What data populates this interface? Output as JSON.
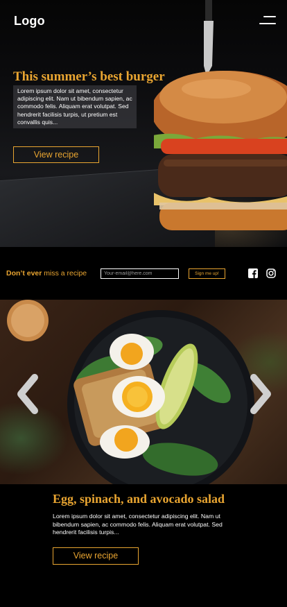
{
  "header": {
    "logo": "Logo"
  },
  "hero": {
    "title": "This summer’s best burger",
    "text": "Lorem ipsum dolor sit amet, consectetur adipiscing elit. Nam ut bibendum sapien, ac commodo felis. Aliquam erat volutpat. Sed hendrerit facilisis turpis, ut pretium est convallis quis...",
    "button": "View recipe"
  },
  "signup": {
    "tag_bold": "Don’t ever",
    "tag_rest": " miss a recipe",
    "email_placeholder": "Your-email@here.com",
    "button": "Sign me up!"
  },
  "feature": {
    "title": "Egg, spinach, and avocado salad",
    "text": "Lorem ipsum dolor sit amet, consectetur adipiscing elit. Nam ut bibendum sapien, ac commodo felis. Aliquam erat volutpat. Sed hendrerit facilisis turpis...",
    "button": "View recipe"
  },
  "colors": {
    "accent": "#e9a531",
    "background": "#000000"
  },
  "icons": [
    "hamburger-menu-icon",
    "facebook-icon",
    "instagram-icon",
    "chevron-left-icon",
    "chevron-right-icon"
  ]
}
